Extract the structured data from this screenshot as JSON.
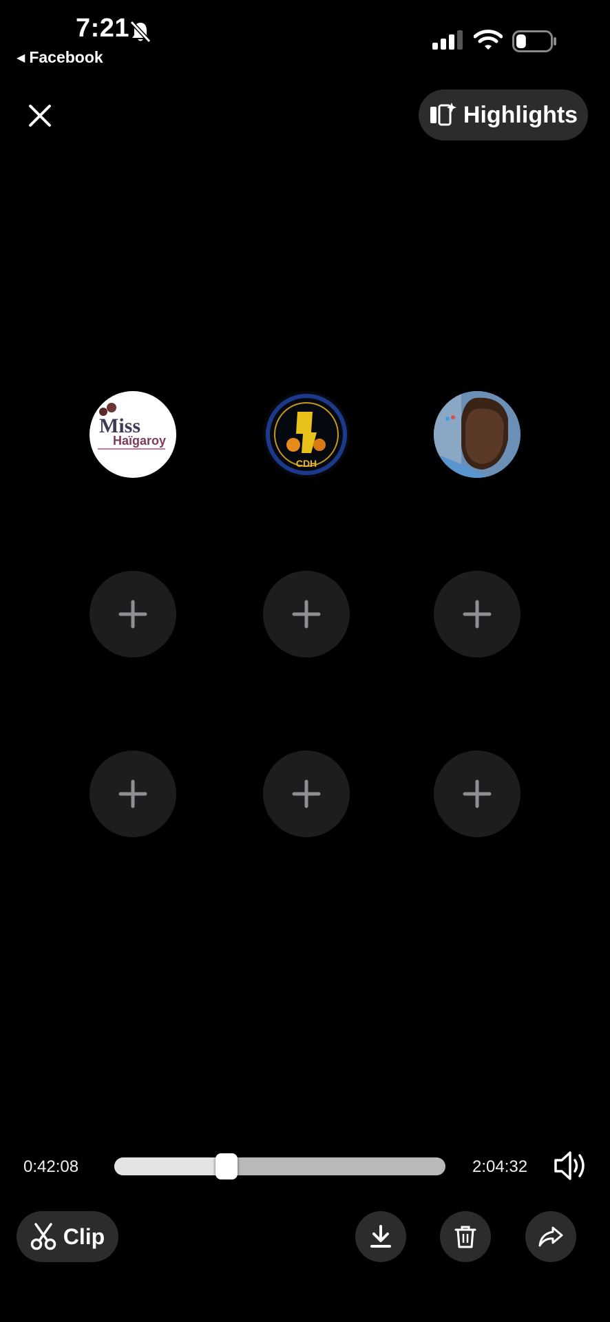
{
  "status_bar": {
    "time": "7:21",
    "back_app": "Facebook",
    "icons": [
      "bell-slash-icon",
      "signal-icon",
      "wifi-icon",
      "battery-icon"
    ],
    "battery_level": 0.3
  },
  "top_bar": {
    "close_icon": "close-icon",
    "highlights_label": "Highlights",
    "highlights_icon": "highlights-icon"
  },
  "grid": {
    "avatars": [
      {
        "name": "avatar-miss",
        "logo_text": "Miss"
      },
      {
        "name": "avatar-cdh",
        "logo_text": "CDH"
      },
      {
        "name": "avatar-person"
      }
    ],
    "empty_slots": 6,
    "add_icon": "plus-icon"
  },
  "player": {
    "current_time": "0:42:08",
    "total_time": "2:04:32",
    "progress": 0.338,
    "volume_icon": "speaker-icon"
  },
  "actions": {
    "clip_label": "Clip",
    "buttons": [
      "download-icon",
      "trash-icon",
      "share-icon"
    ]
  },
  "colors": {
    "background": "#000000",
    "button_bg": "#2c2c2e",
    "slot_bg": "#1d1d1f",
    "track": "#b9b9bb"
  }
}
